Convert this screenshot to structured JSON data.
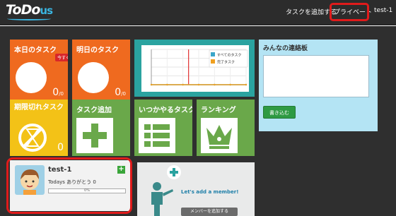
{
  "header": {
    "logo_main": "ToDo",
    "logo_suffix": "us",
    "nav_add_task": "タスクを追加する",
    "nav_private": "プライベート",
    "nav_user": "test-1"
  },
  "tiles": {
    "today": {
      "title": "本日のタスク",
      "badge": "今すぐ×0",
      "count": "0",
      "count_suffix": "/0"
    },
    "tomorrow": {
      "title": "明日のタスク",
      "count": "0",
      "count_suffix": "/0"
    },
    "overdue": {
      "title": "期限切れタスク",
      "count": "0"
    },
    "add_task": {
      "title": "タスク追加"
    },
    "someday": {
      "title": "いつかやるタスク"
    },
    "ranking": {
      "title": "ランキング"
    }
  },
  "chart_data": {
    "type": "line",
    "legend": [
      "すべてのタスク",
      "完了タスク"
    ],
    "colors": [
      "#3aa6c9",
      "#f0a020"
    ],
    "legend_placement": "top-right",
    "series": [
      {
        "name": "すべてのタスク",
        "values": [
          0,
          0,
          0,
          0,
          0,
          0,
          0
        ]
      },
      {
        "name": "完了タスク",
        "values": [
          0,
          0,
          0,
          0,
          0,
          0,
          0
        ]
      }
    ],
    "grid": true
  },
  "board": {
    "title": "みんなの連絡板",
    "textarea_value": "",
    "submit_label": "書き込む"
  },
  "profile": {
    "name": "test-1",
    "thanks_text": "Todays ありがとう 0",
    "progress_label": "0%",
    "progress": 0
  },
  "add_member": {
    "text": "Let's add a member!",
    "button": "メンバーを追加する"
  }
}
